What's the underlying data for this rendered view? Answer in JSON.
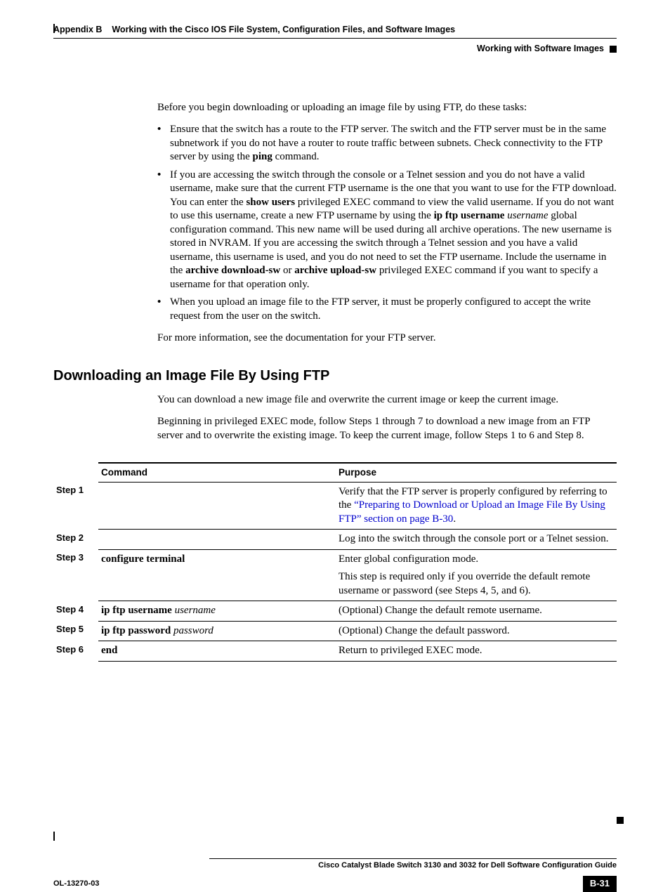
{
  "header": {
    "appendix": "Appendix B",
    "title": "Working with the Cisco IOS File System, Configuration Files, and Software Images",
    "sub": "Working with Software Images"
  },
  "intro": "Before you begin downloading or uploading an image file by using FTP, do these tasks:",
  "bullets": {
    "b1a": "Ensure that the switch has a route to the FTP server. The switch and the FTP server must be in the same subnetwork if you do not have a router to route traffic between subnets. Check connectivity to the FTP server by using the ",
    "b1b": "ping",
    "b1c": " command.",
    "b2a": "If you are accessing the switch through the console or a Telnet session and you do not have a valid username, make sure that the current FTP username is the one that you want to use for the FTP download. You can enter the ",
    "b2b": "show users",
    "b2c": " privileged EXEC command to view the valid username. If you do not want to use this username, create a new FTP username by using the ",
    "b2d": "ip ftp username",
    "b2e": " ",
    "b2f": "username",
    "b2g": " global configuration command. This new name will be used during all archive operations. The new username is stored in NVRAM. If you are accessing the switch through a Telnet session and you have a valid username, this username is used, and you do not need to set the FTP username. Include the username in the ",
    "b2h": "archive download-sw",
    "b2i": " or ",
    "b2j": "archive upload-sw",
    "b2k": " privileged EXEC command if you want to specify a username for that operation only.",
    "b3": "When you upload an image file to the FTP server, it must be properly configured to accept the write request from the user on the switch."
  },
  "closing": "For more information, see the documentation for your FTP server.",
  "section": "Downloading an Image File By Using FTP",
  "sec_p1": "You can download a new image file and overwrite the current image or keep the current image.",
  "sec_p2": "Beginning in privileged EXEC mode, follow Steps 1 through 7 to download a new image from an FTP server and to overwrite the existing image. To keep the current image, follow Steps 1 to 6 and Step 8.",
  "table": {
    "head_cmd": "Command",
    "head_purpose": "Purpose",
    "rows": [
      {
        "step": "Step 1",
        "cmd": "",
        "purpose_pre": "Verify that the FTP server is properly configured by referring to the ",
        "purpose_link": "“Preparing to Download or Upload an Image File By Using FTP” section on page B-30",
        "purpose_post": "."
      },
      {
        "step": "Step 2",
        "cmd": "",
        "purpose": "Log into the switch through the console port or a Telnet session."
      },
      {
        "step": "Step 3",
        "cmd_bold": "configure terminal",
        "purpose1": "Enter global configuration mode.",
        "purpose2": "This step is required only if you override the default remote username or password (see Steps 4, 5, and 6)."
      },
      {
        "step": "Step 4",
        "cmd_bold": "ip ftp username",
        "cmd_ital": "username",
        "purpose": "(Optional) Change the default remote username."
      },
      {
        "step": "Step 5",
        "cmd_bold": "ip ftp password",
        "cmd_ital": "password",
        "purpose": "(Optional) Change the default password."
      },
      {
        "step": "Step 6",
        "cmd_bold": "end",
        "purpose": "Return to privileged EXEC mode."
      }
    ]
  },
  "footer": {
    "guide": "Cisco Catalyst Blade Switch 3130 and 3032 for Dell Software Configuration Guide",
    "ol": "OL-13270-03",
    "page": "B-31"
  }
}
